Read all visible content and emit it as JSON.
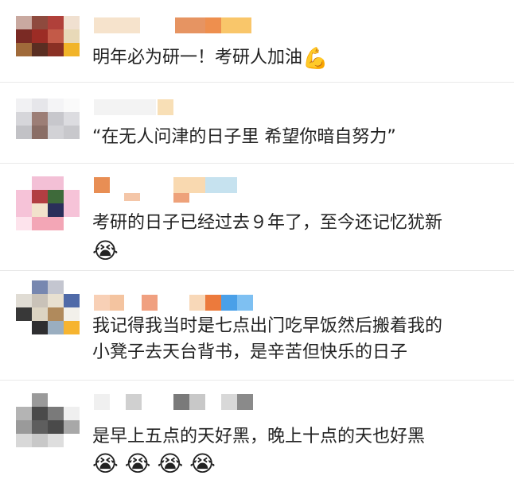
{
  "comments": [
    {
      "text": "明年必为研一！考研人加油",
      "emoji_after": "💪"
    },
    {
      "text": "“在无人问津的日子里 希望你暗自努力”"
    },
    {
      "text": "考研的日子已经过去９年了，至今还记忆犹新",
      "emoji_row": [
        "😭"
      ]
    },
    {
      "lines": [
        "我记得我当时是七点出门吃早饭然后搬着我的",
        "小凳子去天台背书，是辛苦但快乐的日子"
      ]
    },
    {
      "text": "是早上五点的天好黑，晚上十点的天也好黑",
      "emoji_row": [
        "😭",
        "😭",
        "😭",
        "😭"
      ]
    }
  ]
}
